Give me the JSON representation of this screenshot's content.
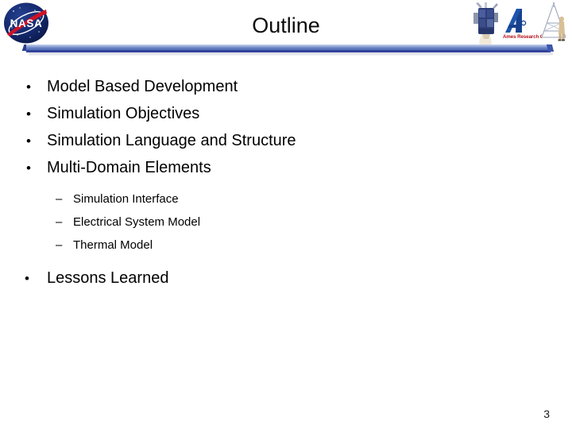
{
  "slide": {
    "title": "Outline",
    "page_number": "3"
  },
  "branding": {
    "nasa_logo_alt": "NASA",
    "nasa_wordmark": "NASA",
    "ames_logo_text": "Ames Research Center",
    "spacecraft_logo_alt": "spacecraft",
    "lander_logo_alt": "lander test structure"
  },
  "colors": {
    "divider_light": "#c9d4ea",
    "divider_mid": "#6b84c4",
    "divider_dark": "#32439a",
    "nasa_blue": "#12286b",
    "nasa_red": "#c8102e",
    "ames_red": "#b5121b",
    "text": "#000000"
  },
  "outline": {
    "items": [
      {
        "marker": "•",
        "label": "Model Based Development",
        "level": 1
      },
      {
        "marker": "•",
        "label": "Simulation Objectives",
        "level": 1
      },
      {
        "marker": "•",
        "label": "Simulation Language and Structure",
        "level": 1
      },
      {
        "marker": "•",
        "label": "Multi-Domain Elements",
        "level": 1
      }
    ],
    "sub_items": [
      {
        "marker": "–",
        "label": "Simulation Interface",
        "level": 2
      },
      {
        "marker": "–",
        "label": "Electrical System Model",
        "level": 2
      },
      {
        "marker": "–",
        "label": "Thermal Model",
        "level": 2
      }
    ],
    "final_item": {
      "marker": "•",
      "label": "Lessons Learned",
      "level": 1
    }
  }
}
